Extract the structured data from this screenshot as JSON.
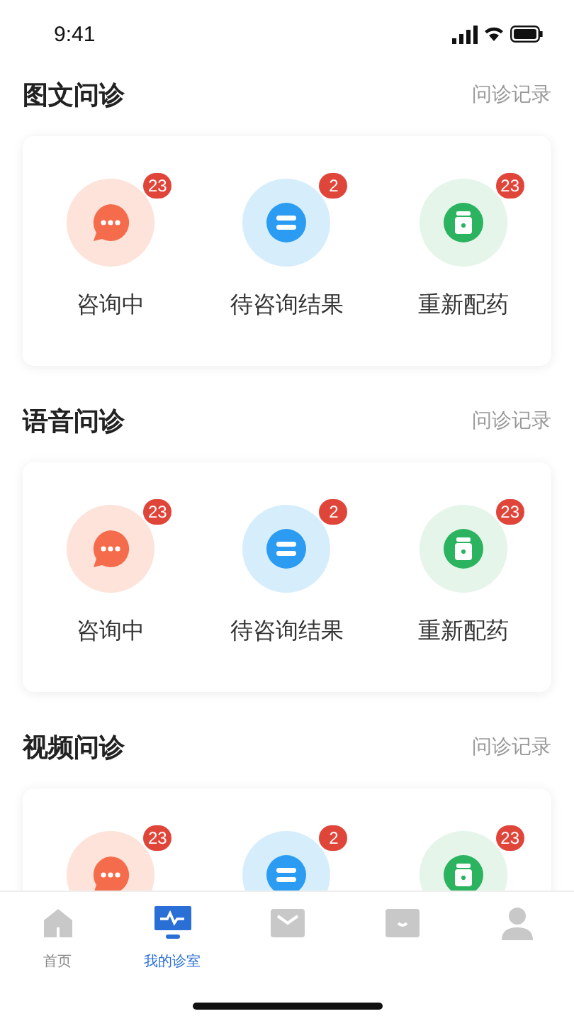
{
  "status_bar": {
    "time": "9:41"
  },
  "sections": [
    {
      "title": "图文问诊",
      "link": "问诊记录",
      "items": [
        {
          "kind": "chat",
          "label": "咨询中",
          "badge": "23"
        },
        {
          "kind": "list",
          "label": "待咨询结果",
          "badge": "2"
        },
        {
          "kind": "medicine",
          "label": "重新配药",
          "badge": "23"
        }
      ]
    },
    {
      "title": "语音问诊",
      "link": "问诊记录",
      "items": [
        {
          "kind": "chat",
          "label": "咨询中",
          "badge": "23"
        },
        {
          "kind": "list",
          "label": "待咨询结果",
          "badge": "2"
        },
        {
          "kind": "medicine",
          "label": "重新配药",
          "badge": "23"
        }
      ]
    },
    {
      "title": "视频问诊",
      "link": "问诊记录",
      "items": [
        {
          "kind": "chat",
          "badge": "23"
        },
        {
          "kind": "list",
          "badge": "2"
        },
        {
          "kind": "medicine",
          "badge": "23"
        }
      ]
    }
  ],
  "tab_bar": [
    {
      "kind": "home",
      "label": "首页",
      "selected": false
    },
    {
      "kind": "monitor",
      "label": "我的诊室",
      "selected": true
    },
    {
      "kind": "inbox",
      "selected": false
    },
    {
      "kind": "message",
      "selected": false
    },
    {
      "kind": "person",
      "selected": false
    }
  ]
}
